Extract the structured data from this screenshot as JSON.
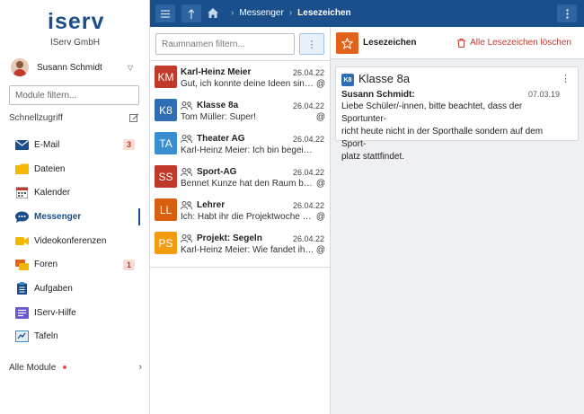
{
  "sidebar": {
    "logo_text": "iserv",
    "company": "IServ GmbH",
    "user_name": "Susann Schmidt",
    "module_filter_placeholder": "Module filtern...",
    "quick_access": "Schnellzugriff",
    "items": [
      {
        "label": "E-Mail",
        "icon": "mail-icon",
        "badge": "3"
      },
      {
        "label": "Dateien",
        "icon": "folder-icon",
        "badge": ""
      },
      {
        "label": "Kalender",
        "icon": "calendar-icon",
        "badge": ""
      },
      {
        "label": "Messenger",
        "icon": "chat-icon",
        "badge": "",
        "active": true
      },
      {
        "label": "Videokonferenzen",
        "icon": "video-icon",
        "badge": ""
      },
      {
        "label": "Foren",
        "icon": "forum-icon",
        "badge": "1"
      },
      {
        "label": "Aufgaben",
        "icon": "tasks-icon",
        "badge": ""
      },
      {
        "label": "IServ-Hilfe",
        "icon": "help-icon",
        "badge": ""
      },
      {
        "label": "Tafeln",
        "icon": "board-icon",
        "badge": ""
      }
    ],
    "all_modules": "Alle Module"
  },
  "topbar": {
    "breadcrumb_1": "Messenger",
    "breadcrumb_2": "Lesezeichen"
  },
  "rooms": {
    "filter_placeholder": "Raumnamen filtern...",
    "list": [
      {
        "initials": "KM",
        "color": "#c0392b",
        "title": "Karl-Heinz Meier",
        "group": false,
        "date": "26.04.22",
        "msg": "Gut, ich konnte deine Ideen sinnvoll einbringen.",
        "at": "@"
      },
      {
        "initials": "K8",
        "color": "#2f6db5",
        "title": "Klasse 8a",
        "group": true,
        "date": "26.04.22",
        "msg": "Tom Müller: Super!",
        "at": "@"
      },
      {
        "initials": "TA",
        "color": "#3a8fd0",
        "title": "Theater AG",
        "group": true,
        "date": "26.04.22",
        "msg": "Karl-Heinz Meier: Ich bin begeistert!",
        "at": ""
      },
      {
        "initials": "SS",
        "color": "#c0392b",
        "title": "Sport-AG",
        "group": true,
        "date": "26.04.22",
        "msg": "Bennet Kunze hat den Raum betreten.",
        "at": "@"
      },
      {
        "initials": "LL",
        "color": "#d95f0e",
        "title": "Lehrer",
        "group": true,
        "date": "26.04.22",
        "msg": "Ich: Habt ihr die Projektwoche geplant?",
        "at": "@"
      },
      {
        "initials": "PS",
        "color": "#f39c12",
        "title": "Projekt: Segeln",
        "group": true,
        "date": "26.04.22",
        "msg": "Karl-Heinz Meier: Wie fandet ihr die Tour?",
        "at": "@"
      }
    ]
  },
  "bookmarks": {
    "title": "Lesezeichen",
    "clear_all": "Alle Lesezeichen löschen",
    "card": {
      "initials": "K8",
      "room": "Klasse 8a",
      "sender": "Susann Schmidt:",
      "date": "07.03.19",
      "text_lines": [
        "Liebe Schüler/-innen, bitte beachtet, dass der Sportunter-",
        "richt heute nicht in der Sporthalle sondern auf dem Sport-",
        "platz stattfindet."
      ]
    }
  },
  "colors": {
    "brand": "#1a4f8b",
    "accent": "#e4611b",
    "danger": "#c0392b"
  }
}
